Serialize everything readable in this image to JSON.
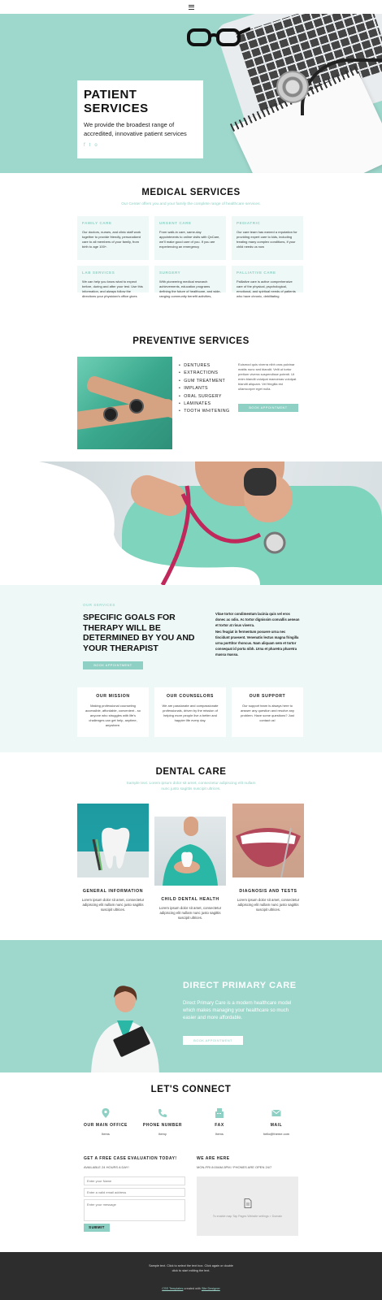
{
  "hero": {
    "title1": "PATIENT",
    "title2": "SERVICES",
    "text": "We provide the broadest range of accredited, innovative patient services",
    "social": [
      "f",
      "t",
      "o"
    ]
  },
  "medical": {
    "title": "MEDICAL SERVICES",
    "subtitle": "Our Center offers you and your family the complete range of healthcare services.",
    "cards": [
      {
        "title": "FAMILY CARE",
        "text": "Our doctors, nurses, and clinic staff work together to provide friendly, personalized care to all members of your family, from birth to age 100+."
      },
      {
        "title": "URGENT CARE",
        "text": "From walk-in care, same-day appointments to online visits with QxCare, we'll make good care of you. If you are experiencing an emergency"
      },
      {
        "title": "PEDIATRIC",
        "text": "Our care team has earned a reputation for providing expert care to kids, including treating many complex conditions, if your child needs us now"
      },
      {
        "title": "LAB SERVICES",
        "text": "We can help you know what to expect before, during and after your test. Use this information, and always follow the directions your physician's office gives"
      },
      {
        "title": "SURGERY",
        "text": "With pioneering medical research achievements, education programs defining the future of healthcare, and wide-ranging community benefit activities,"
      },
      {
        "title": "PALLIATIVE CARE",
        "text": "Palliative care is active comprehensive care of the physical, psychological, emotional, and spiritual needs of patients who have chronic, debilitating"
      }
    ]
  },
  "preventive": {
    "title": "PREVENTIVE SERVICES",
    "items": [
      "DENTURES",
      "EXTRACTIONS",
      "GUM TREATMENT",
      "IMPLANTS",
      "ORAL SURGERY",
      "LAMINATES",
      "TOOTH WHITENING"
    ],
    "text": "Euismod quis viverra nibh cras pulvinar mattis nunc sed blandit. Velit ut tortor pretium viverra suspendisse potenti. Ut enim blandit volutpat maecenas volutpat blandit aliquam. Vel fringilla est ullamcorper eget nulla.",
    "button": "BOOK APPOINTMENT"
  },
  "goals": {
    "label": "OUR SERVICES",
    "title": "SPECIFIC GOALS FOR THERAPY WILL BE DETERMINED BY YOU AND YOUR THERAPIST",
    "p1": "Vitae tortor condimentum lacinia quis vel eros donec ac odio. Ac tortor dignissim convallis aenean et tortor at risus viverra.",
    "p2": "Nec feugiat in fermentum posuere urna nec tincidunt praesent. Venenatis lectus magna fringilla urna porttitor rhoncus. Nam aliquam sem et tortor consequat id porta nibh. Urna et pharetra pharetra massa massa.",
    "button": "BOOK APPOINTMENT",
    "boxes": [
      {
        "title": "OUR MISSION",
        "text": "Making professional counseling accessible, affordable, convenient - so anyone who struggles with life's challenges can get help, anytime, anywhere."
      },
      {
        "title": "OUR COUNSELORS",
        "text": "We are passionate and compassionate professionals, driven by the mission of helping more people live a better and happier life every day."
      },
      {
        "title": "OUR SUPPORT",
        "text": "Our support team is always here to answer any question and resolve any problem. Have some questions? Just contact us!"
      }
    ]
  },
  "dental": {
    "title": "DENTAL CARE",
    "subtitle": "Sample text. Lorem ipsum dolor sit amet, consectetur adipiscing elit nullam nunc justo sagittis suscipit ultrices.",
    "items": [
      {
        "title": "GENERAL INFORMATION",
        "text": "Lorem ipsum dolor sit amet, consectetur adipiscing elit nullam nunc justo sagittis suscipit ultrices."
      },
      {
        "title": "CHILD DENTAL HEALTH",
        "text": "Lorem ipsum dolor sit amet, consectetur adipiscing elit nullam nunc justo sagittis suscipit ultrices."
      },
      {
        "title": "DIAGNOSIS AND TESTS",
        "text": "Lorem ipsum dolor sit amet, consectetur adipiscing elit nullam nunc justo sagittis suscipit ultrices."
      }
    ]
  },
  "primary": {
    "title": "DIRECT PRIMARY CARE",
    "text": "Direct Primary Care is a modern healthcare model which makes managing your healthcare so much easier and more affordable.",
    "button": "BOOK APPOINTMENT"
  },
  "connect": {
    "title": "LET'S CONNECT",
    "items": [
      {
        "icon": "location-pin-icon",
        "title": "OUR MAIN OFFICE",
        "value": "Items"
      },
      {
        "icon": "phone-icon",
        "title": "PHONE NUMBER",
        "value": "Itemy"
      },
      {
        "icon": "fax-icon",
        "title": "FAX",
        "value": "Items"
      },
      {
        "icon": "mail-icon",
        "title": "MAIL",
        "value": "hello@theme.com"
      }
    ],
    "form": {
      "title": "GET A FREE CASE EVALUATION TODAY!",
      "sub": "AVAILABLE 24 HOURS A DAY!",
      "name": "Enter your Name",
      "email": "Enter a valid email address",
      "message": "Enter your message",
      "submit": "SUBMIT"
    },
    "here": {
      "title": "WE ARE HERE",
      "sub": "MON-FRI 8:00AM-5PM / PHONES ARE OPEN 24/7",
      "map_text": "To enable map Tap Pages Website settings > Domain"
    }
  },
  "footer": {
    "line1": "Sample text. Click to select the text box. Click again or double",
    "line2": "click to start editing the text.",
    "link1": "CSS Templates",
    "mid": " created with ",
    "link2": "Site Designer"
  },
  "colors": {
    "accent": "#8fd0c4",
    "hero_bg": "#9ed8cd",
    "light_bg": "#eef8f6",
    "footer": "#2d2d2d"
  }
}
